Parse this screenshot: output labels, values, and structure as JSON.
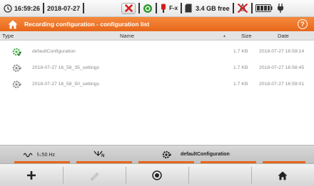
{
  "status_bar": {
    "time": "16:59:26",
    "date": "2018-07-27",
    "fx_label": "F-x",
    "storage": "3.4 GB free"
  },
  "title_bar": {
    "title": "Recording configuration - configuration list",
    "help_label": "?"
  },
  "table": {
    "headers": {
      "type": "Type",
      "name": "Name",
      "size": "Size",
      "date": "Date"
    },
    "rows": [
      {
        "name": "defaultConfiguration",
        "size": "1.7 KB",
        "date": "2018-07-27 16:59:14",
        "active": true
      },
      {
        "name": "2018-07-27 16_58_35_settings",
        "size": "1.7 KB",
        "date": "2018-07-27 16:58:45",
        "active": false
      },
      {
        "name": "2018-07-27 16_58_50_settings",
        "size": "1.7 KB",
        "date": "2018-07-27 16:59:01",
        "active": false
      }
    ]
  },
  "info_bar": {
    "frequency": "fₙ:50 Hz",
    "network_label": "N",
    "active_config": "defaultConfiguration"
  },
  "toolbar": {
    "buttons": [
      "add-icon",
      "edit-icon",
      "activate-icon",
      "home-icon"
    ]
  },
  "colors": {
    "accent": "#e8671a",
    "active_config": "#4caf50",
    "alarm": "#d81b1b"
  }
}
